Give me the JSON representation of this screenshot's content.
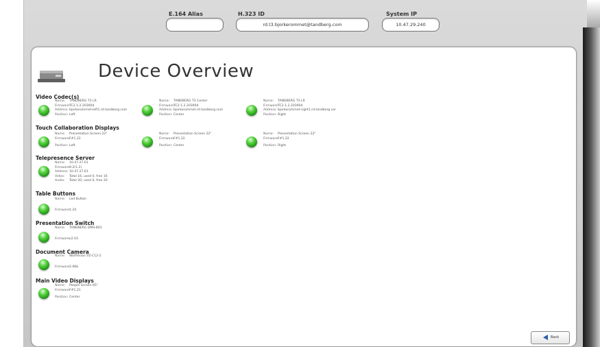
{
  "header": {
    "e164": {
      "label": "E.164 Alias",
      "value": ""
    },
    "h323": {
      "label": "H.323 ID",
      "value": "rd.t3.bjorkerommet@tandberg.com"
    },
    "ip": {
      "label": "System IP",
      "value": "10.47.29.240"
    }
  },
  "page_title": "Device Overview",
  "back_label": "Back",
  "status_color": "#3fbf2a",
  "sections": {
    "video_codecs": {
      "title": "Video Codec(s)",
      "items": [
        {
          "name_k": "Name:",
          "name": "TANDBERG T3 LR",
          "fw_k": "Firmware:",
          "fw": "TC2.1.2.203904",
          "addr_k": "Address:",
          "addr": "bjorkerommet-left1.rd.tandberg.com",
          "pos_k": "Position:",
          "pos": "Left"
        },
        {
          "name_k": "Name:",
          "name": "TANDBERG T3 Center",
          "fw_k": "Firmware:",
          "fw": "TC2.1.2.203904",
          "addr_k": "Address:",
          "addr": "bjorkerommet.rd.tandberg.com",
          "pos_k": "Position:",
          "pos": "Center"
        },
        {
          "name_k": "Name:",
          "name": "TANDBERG T3 LR",
          "fw_k": "Firmware:",
          "fw": "TC2.1.2.203904",
          "addr_k": "Address:",
          "addr": "bjorkerommet-right1.rd.tandberg.cor",
          "pos_k": "Position:",
          "pos": "Right"
        }
      ]
    },
    "touch_displays": {
      "title": "Touch Collaboration Displays",
      "items": [
        {
          "name_k": "Name:",
          "name": "Presentation Screen 22\"",
          "fw_k": "Firmware:",
          "fw": "F#1.22",
          "pos_k": "Position:",
          "pos": "Left"
        },
        {
          "name_k": "Name:",
          "name": "Presentation Screen 22\"",
          "fw_k": "Firmware:",
          "fw": "F#1.22",
          "pos_k": "Position:",
          "pos": "Center"
        },
        {
          "name_k": "Name:",
          "name": "Presentation Screen 22\"",
          "fw_k": "Firmware:",
          "fw": "F#1.22",
          "pos_k": "Position:",
          "pos": "Right"
        }
      ]
    },
    "telepresence_server": {
      "title": "Telepresence Server",
      "name_k": "Name:",
      "name": "10.47.27.61",
      "fw_k": "Firmware:",
      "fw": "9.2(1.2)",
      "addr_k": "Address:",
      "addr": "10.47.27.61",
      "video_k": "Video:",
      "video": "Total 16, used 0, free 16",
      "audio_k": "Audio:",
      "audio": "Total 20, used 0, free 20"
    },
    "table_buttons": {
      "title": "Table Buttons",
      "name_k": "Name:",
      "name": "Led Button",
      "fw_k": "Firmware:",
      "fw": "1.24"
    },
    "presentation_switch": {
      "title": "Presentation Switch",
      "name_k": "Name:",
      "name": "TANDBERG DMS-801",
      "fw_k": "Firmware:",
      "fw": "v2.03"
    },
    "document_camera": {
      "title": "Document Camera",
      "name_k": "Name:",
      "name": "WolfVision VZ-C12-2",
      "fw_k": "Firmware:",
      "fw": "2.06b"
    },
    "main_video_displays": {
      "title": "Main Video Displays",
      "name_k": "Name:",
      "name": "People Screen 65\"",
      "fw_k": "Firmware:",
      "fw": "F#1.21",
      "pos_k": "Position:",
      "pos": "Center"
    }
  }
}
